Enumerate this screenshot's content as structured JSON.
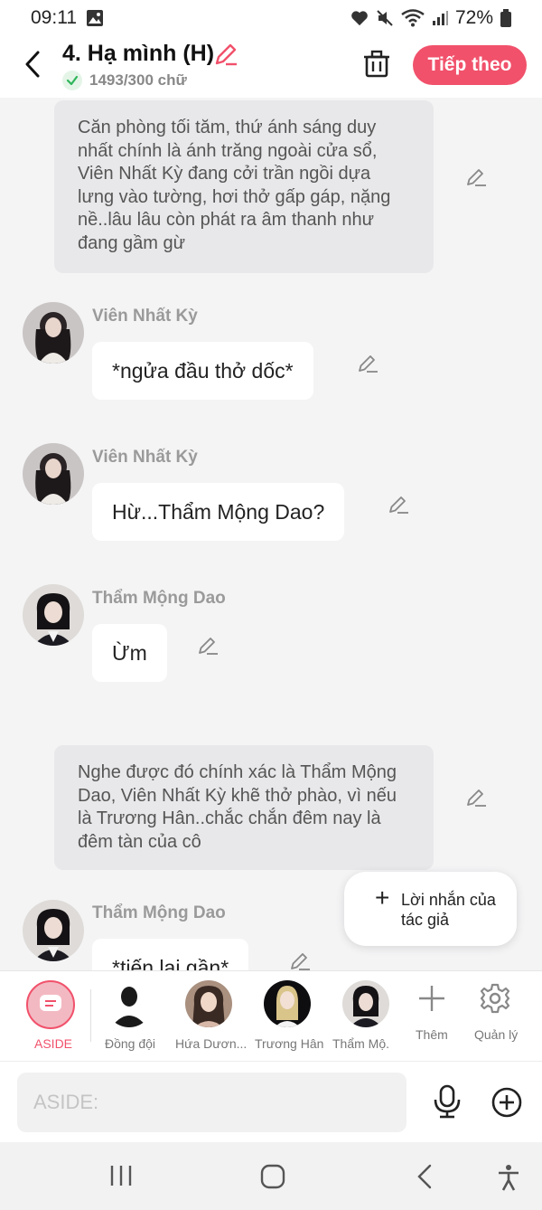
{
  "status_bar": {
    "time": "09:11",
    "battery": "72%"
  },
  "header": {
    "title": "4. Hạ mình (H)",
    "word_count": "1493/300 chữ",
    "next_label": "Tiếp theo"
  },
  "messages": {
    "narration1": "Căn phòng tối tăm, thứ ánh sáng duy nhất chính là ánh trăng ngoài cửa sổ, Viên Nhất Kỳ đang cởi trần ngồi dựa lưng vào tường, hơi thở gấp gáp, nặng nề..lâu lâu còn phát ra âm thanh như đang gầm gừ",
    "msg1": {
      "name": "Viên Nhất Kỳ",
      "text": "*ngửa đầu thở dốc*"
    },
    "msg2": {
      "name": "Viên Nhất Kỳ",
      "text": "Hừ...Thẩm Mộng Dao?"
    },
    "msg3": {
      "name": "Thẩm Mộng Dao",
      "text": "Ừm"
    },
    "narration2": "Nghe được đó chính xác là Thẩm Mộng Dao, Viên Nhất Kỳ khẽ thở phào, vì nếu là Trương Hân..chắc chắn đêm nay là đêm tàn của cô",
    "msg4": {
      "name": "Thẩm Mộng Dao",
      "text": "*tiến lại gần*"
    }
  },
  "author_note": {
    "label": "Lời nhắn của tác giả"
  },
  "characters": [
    {
      "label": "ASIDE"
    },
    {
      "label": "Đồng đội"
    },
    {
      "label": "Hứa Dươn..."
    },
    {
      "label": "Trương Hân"
    },
    {
      "label": "Thẩm Mộ."
    },
    {
      "label": "Thêm"
    },
    {
      "label": "Quản lý"
    }
  ],
  "input": {
    "placeholder": "ASIDE:"
  },
  "colors": {
    "accent": "#f1516b",
    "bubble_bg": "#ffffff",
    "narration_bg": "#e8e8ea",
    "background": "#f4f4f5"
  }
}
